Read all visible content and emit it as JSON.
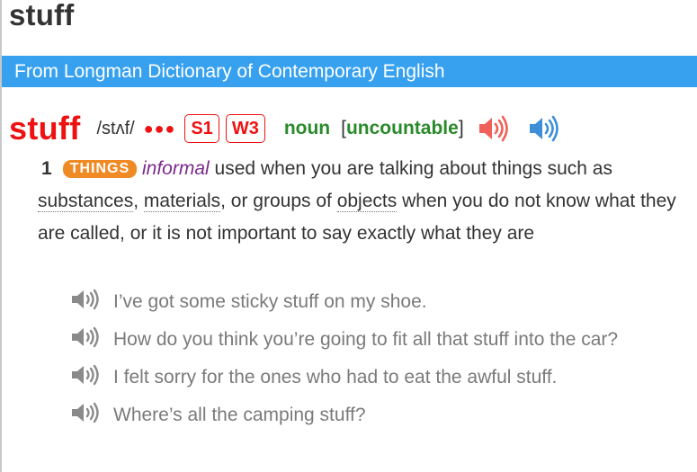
{
  "page": {
    "title": "stuff"
  },
  "banner": {
    "text": "From Longman Dictionary of Contemporary English"
  },
  "entry": {
    "headword": "stuff",
    "pronunciation": "/stʌf/",
    "frequency_dots": "●●●",
    "spoken_freq": "S1",
    "written_freq": "W3",
    "part_of_speech": "noun",
    "grammar": "uncountable",
    "grammar_open": "[",
    "grammar_close": "]",
    "audio_icons": [
      "british-audio-icon",
      "american-audio-icon"
    ]
  },
  "sense": {
    "number": "1",
    "signpost": "THINGS",
    "register": "informal",
    "def_1": "used when you are talking about things such as",
    "link_substances": "substances",
    "sep_1": ",",
    "link_materials": "materials",
    "def_2": ", or groups of",
    "link_objects": "objects",
    "def_3": "when you do not know what they are called, or it is not important to say exactly what they are"
  },
  "examples": [
    {
      "text": "I’ve got some sticky stuff on my shoe."
    },
    {
      "text": "How do you think you’re going to fit all that stuff into the car?"
    },
    {
      "text": "I felt sorry for the ones who had to eat the awful stuff."
    },
    {
      "text": "Where’s all the camping stuff?"
    }
  ],
  "colors": {
    "headword": "#ee1111",
    "banner": "#37a1ef",
    "signpost": "#f08a24",
    "pos": "#2a8a2a",
    "register": "#7b2a8c",
    "example_text": "#7a7a7a",
    "british_audio": "#f0615a",
    "american_audio": "#3d8fd8"
  }
}
